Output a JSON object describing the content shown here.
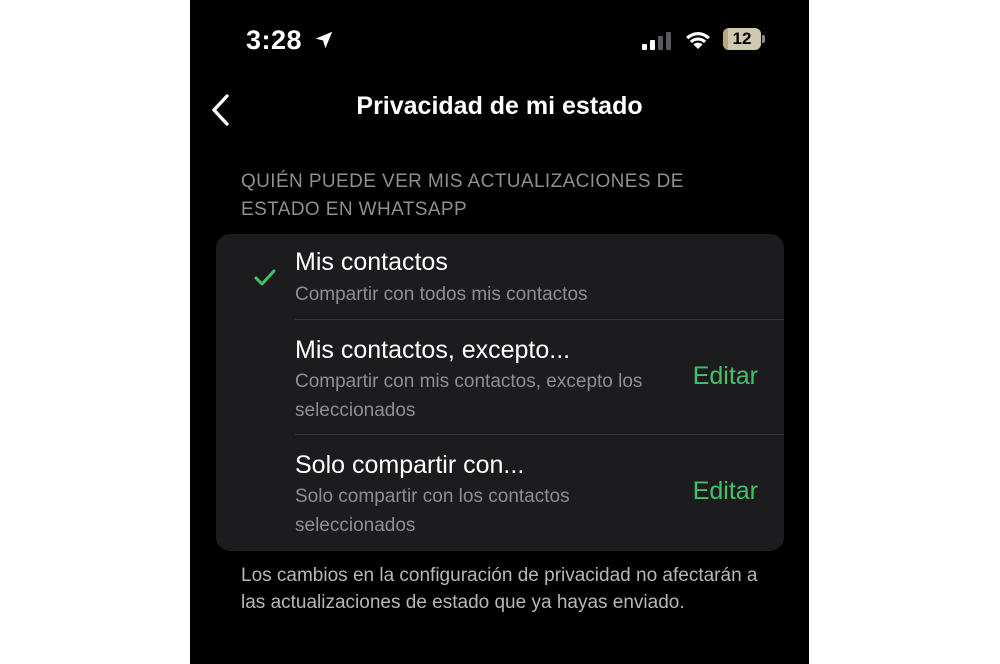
{
  "status_bar": {
    "time": "3:28",
    "battery_level": "12",
    "battery_fraction": 0.12,
    "icons": [
      "location-arrow-icon",
      "cellular-signal-icon",
      "wifi-icon",
      "battery-icon"
    ]
  },
  "nav": {
    "title": "Privacidad de mi estado",
    "back_icon": "chevron-left-icon"
  },
  "section_header": "QUIÉN PUEDE VER MIS ACTUALIZACIONES DE ESTADO EN WHATSAPP",
  "options": [
    {
      "title": "Mis contactos",
      "subtitle": "Compartir con todos mis contactos",
      "selected": true
    },
    {
      "title": "Mis contactos, excepto...",
      "subtitle": "Compartir con mis contactos, excepto los seleccionados",
      "action": "Editar"
    },
    {
      "title": "Solo compartir con...",
      "subtitle": "Solo compartir con los contactos seleccionados",
      "action": "Editar"
    }
  ],
  "footer_note": "Los cambios en la configuración de privacidad no afectarán a las actualizaciones de estado que ya hayas enviado.",
  "colors": {
    "background": "#000000",
    "card": "#1c1c1e",
    "accent_green": "#3fc26a",
    "secondary_text": "#8e8e93"
  }
}
